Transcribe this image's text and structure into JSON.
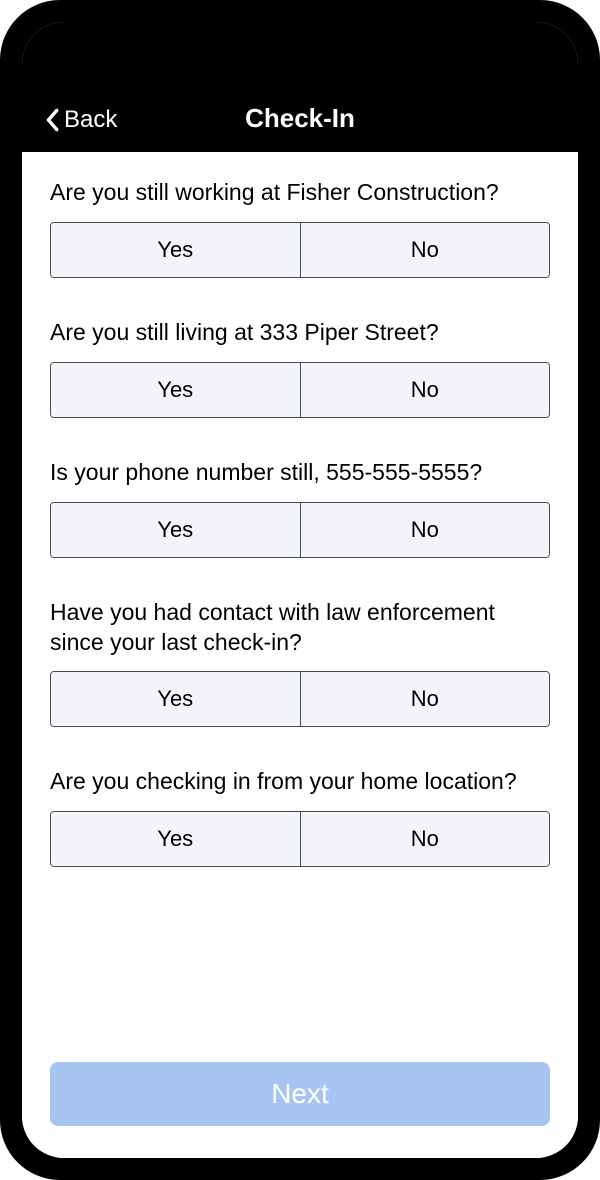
{
  "header": {
    "back_label": "Back",
    "title": "Check-In"
  },
  "questions": [
    {
      "text": "Are you still working at Fisher Construction?",
      "yes": "Yes",
      "no": "No"
    },
    {
      "text": "Are you still living at 333 Piper Street?",
      "yes": "Yes",
      "no": "No"
    },
    {
      "text": "Is your phone number still, 555-555-5555?",
      "yes": "Yes",
      "no": "No"
    },
    {
      "text": "Have you had contact with law enforcement since your last check-in?",
      "yes": "Yes",
      "no": "No"
    },
    {
      "text": "Are you checking in from your home location?",
      "yes": "Yes",
      "no": "No"
    }
  ],
  "next_label": "Next"
}
